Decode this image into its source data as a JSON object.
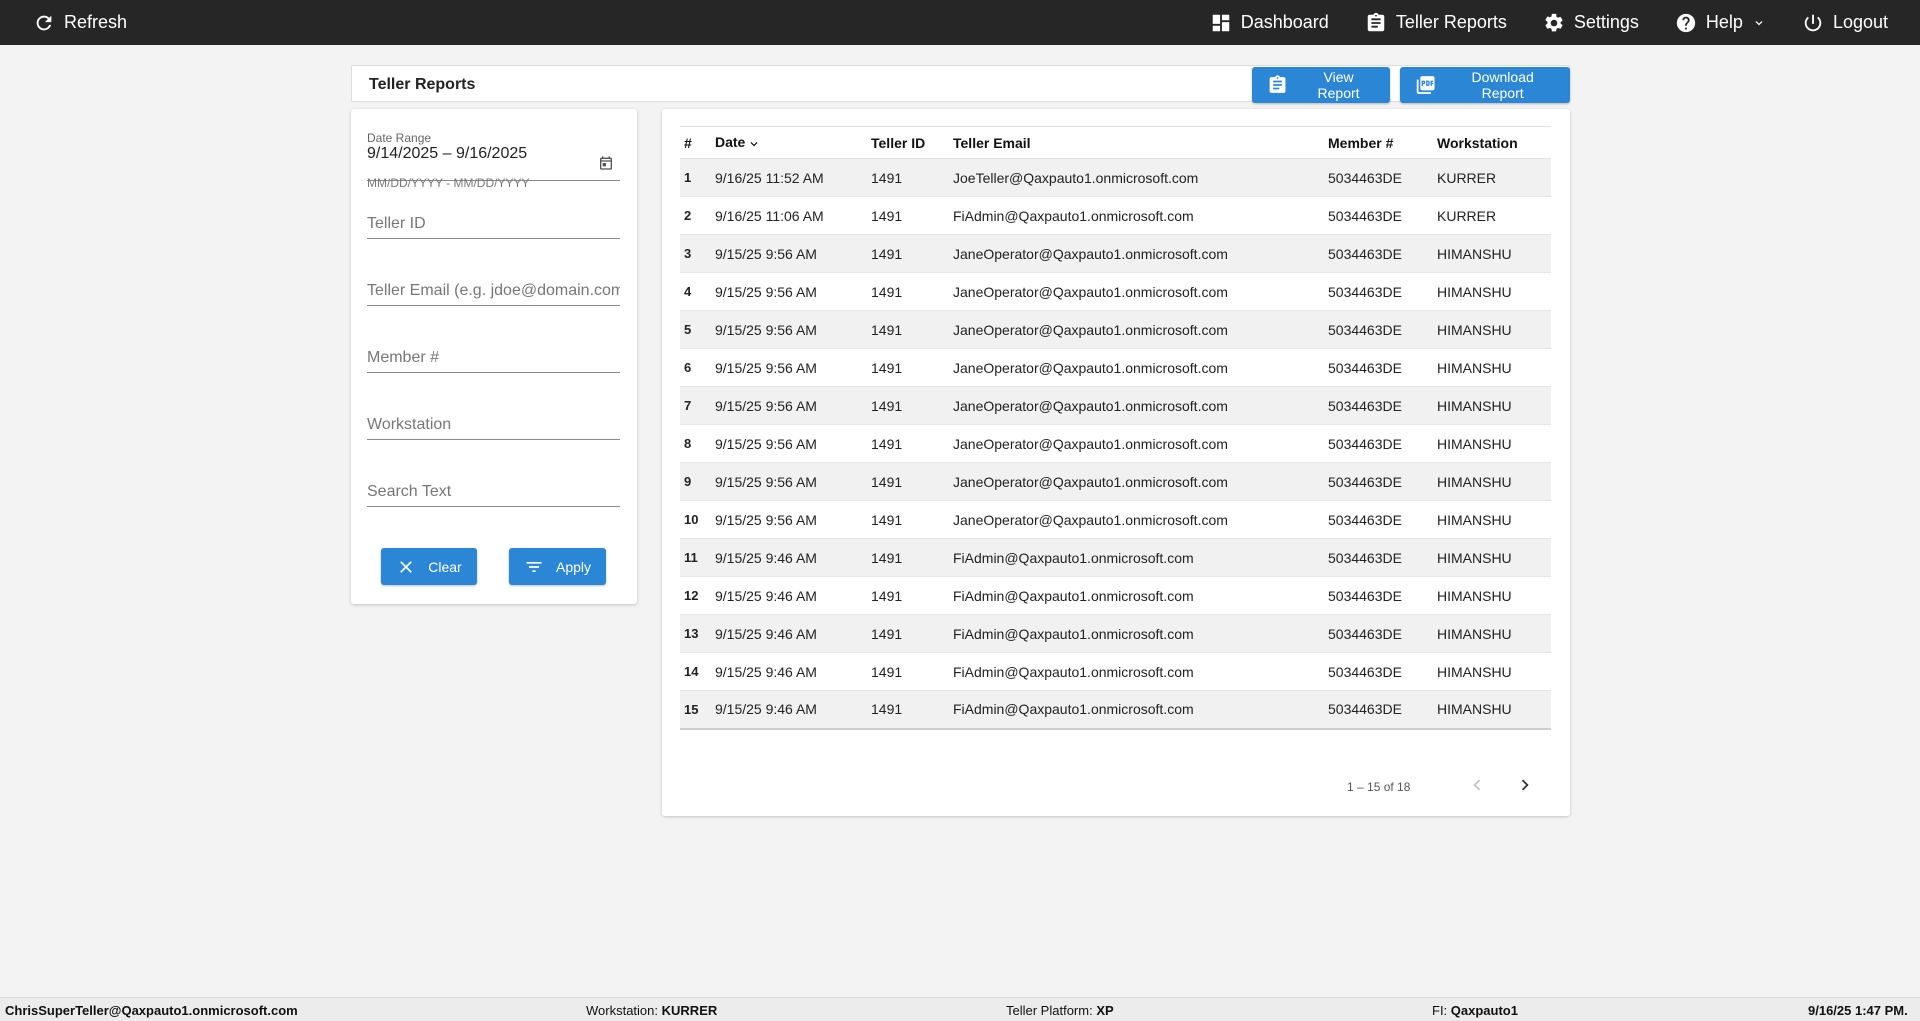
{
  "topbar": {
    "refresh_label": "Refresh",
    "nav": {
      "dashboard": "Dashboard",
      "teller_reports": "Teller Reports",
      "settings": "Settings",
      "help": "Help",
      "logout": "Logout"
    }
  },
  "header": {
    "title": "Teller Reports",
    "view_report": "View Report",
    "download_report": "Download Report"
  },
  "filters": {
    "date_range_label": "Date Range",
    "date_range_value": "9/14/2025 – 9/16/2025",
    "date_hint": "MM/DD/YYYY - MM/DD/YYYY",
    "teller_id_placeholder": "Teller ID",
    "teller_email_placeholder": "Teller Email (e.g. jdoe@domain.com)",
    "member_placeholder": "Member #",
    "workstation_placeholder": "Workstation",
    "search_placeholder": "Search Text",
    "clear_label": "Clear",
    "apply_label": "Apply"
  },
  "table": {
    "columns": [
      "#",
      "Date",
      "Teller ID",
      "Teller Email",
      "Member #",
      "Workstation"
    ],
    "rows": [
      [
        "1",
        "9/16/25 11:52 AM",
        "1491",
        "JoeTeller@Qaxpauto1.onmicrosoft.com",
        "5034463DE",
        "KURRER"
      ],
      [
        "2",
        "9/16/25 11:06 AM",
        "1491",
        "FiAdmin@Qaxpauto1.onmicrosoft.com",
        "5034463DE",
        "KURRER"
      ],
      [
        "3",
        "9/15/25 9:56 AM",
        "1491",
        "JaneOperator@Qaxpauto1.onmicrosoft.com",
        "5034463DE",
        "HIMANSHU"
      ],
      [
        "4",
        "9/15/25 9:56 AM",
        "1491",
        "JaneOperator@Qaxpauto1.onmicrosoft.com",
        "5034463DE",
        "HIMANSHU"
      ],
      [
        "5",
        "9/15/25 9:56 AM",
        "1491",
        "JaneOperator@Qaxpauto1.onmicrosoft.com",
        "5034463DE",
        "HIMANSHU"
      ],
      [
        "6",
        "9/15/25 9:56 AM",
        "1491",
        "JaneOperator@Qaxpauto1.onmicrosoft.com",
        "5034463DE",
        "HIMANSHU"
      ],
      [
        "7",
        "9/15/25 9:56 AM",
        "1491",
        "JaneOperator@Qaxpauto1.onmicrosoft.com",
        "5034463DE",
        "HIMANSHU"
      ],
      [
        "8",
        "9/15/25 9:56 AM",
        "1491",
        "JaneOperator@Qaxpauto1.onmicrosoft.com",
        "5034463DE",
        "HIMANSHU"
      ],
      [
        "9",
        "9/15/25 9:56 AM",
        "1491",
        "JaneOperator@Qaxpauto1.onmicrosoft.com",
        "5034463DE",
        "HIMANSHU"
      ],
      [
        "10",
        "9/15/25 9:56 AM",
        "1491",
        "JaneOperator@Qaxpauto1.onmicrosoft.com",
        "5034463DE",
        "HIMANSHU"
      ],
      [
        "11",
        "9/15/25 9:46 AM",
        "1491",
        "FiAdmin@Qaxpauto1.onmicrosoft.com",
        "5034463DE",
        "HIMANSHU"
      ],
      [
        "12",
        "9/15/25 9:46 AM",
        "1491",
        "FiAdmin@Qaxpauto1.onmicrosoft.com",
        "5034463DE",
        "HIMANSHU"
      ],
      [
        "13",
        "9/15/25 9:46 AM",
        "1491",
        "FiAdmin@Qaxpauto1.onmicrosoft.com",
        "5034463DE",
        "HIMANSHU"
      ],
      [
        "14",
        "9/15/25 9:46 AM",
        "1491",
        "FiAdmin@Qaxpauto1.onmicrosoft.com",
        "5034463DE",
        "HIMANSHU"
      ],
      [
        "15",
        "9/15/25 9:46 AM",
        "1491",
        "FiAdmin@Qaxpauto1.onmicrosoft.com",
        "5034463DE",
        "HIMANSHU"
      ]
    ],
    "pagination": "1 – 15 of 18"
  },
  "footer": {
    "user": "ChrisSuperTeller@Qaxpauto1.onmicrosoft.com",
    "workstation_label": "Workstation:",
    "workstation_value": "KURRER",
    "platform_label": "Teller Platform:",
    "platform_value": "XP",
    "fi_label": "FI:",
    "fi_value": "Qaxpauto1",
    "datetime": "9/16/25 1:47 PM."
  },
  "icons": {
    "refresh": "refresh-icon",
    "dashboard": "dashboard-icon",
    "teller_reports": "clipboard-icon",
    "settings": "gear-icon",
    "help": "help-circle-icon",
    "logout": "power-icon"
  },
  "colors": {
    "topbar": "#262626",
    "primary_button": "#2b87d6",
    "background": "#f3f3f3"
  }
}
